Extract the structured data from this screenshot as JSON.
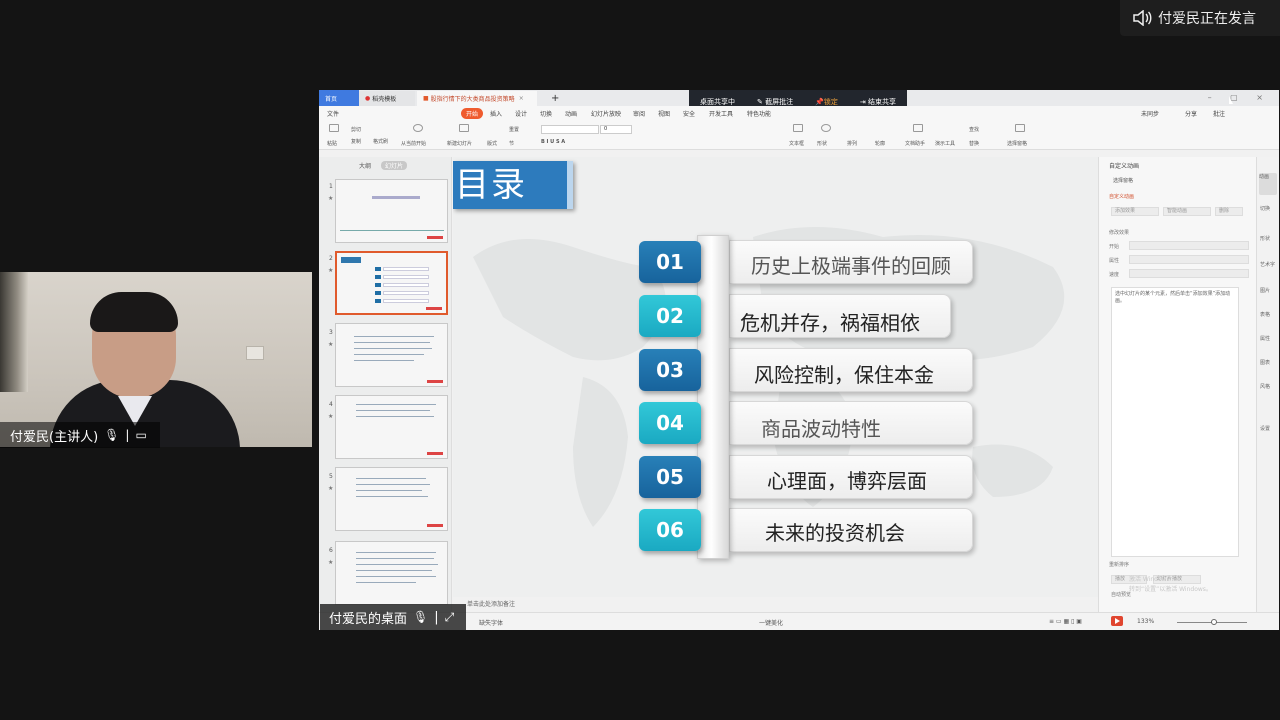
{
  "speaking_indicator": {
    "text": "付爱民正在发言",
    "icon": "speaker-icon"
  },
  "camera": {
    "name_label": "付爱民(主讲人)",
    "icons": [
      "mic-icon",
      "screen-icon"
    ]
  },
  "desktop_label": {
    "text": "付爱民的桌面",
    "icons": [
      "mic-icon",
      "expand-icon"
    ]
  },
  "wps": {
    "tabs": [
      {
        "label": "首页"
      },
      {
        "label": "稻壳模板"
      },
      {
        "label": "股指行情下的大类商品投资策略"
      }
    ],
    "share_bar": {
      "desktop_sharing": "桌面共享中",
      "annotate": "截屏批注",
      "pin": "锁定",
      "end_share": "结束共享"
    },
    "menu": [
      "文件",
      "开始",
      "插入",
      "设计",
      "切换",
      "动画",
      "幻灯片放映",
      "审阅",
      "视图",
      "安全",
      "开发工具",
      "特色功能"
    ],
    "menu_right": [
      "未同步",
      "分享",
      "批注"
    ],
    "ribbon_labels": [
      "粘贴",
      "剪切",
      "复制",
      "格式刷",
      "从当前开始",
      "新建幻灯片",
      "版式",
      "节",
      "重置",
      "文本框",
      "形状",
      "排列",
      "轮廓",
      "文档助手",
      "演示工具",
      "替换",
      "选择窗格",
      "查找"
    ],
    "font_size": "0",
    "thumb_tabs": {
      "outline": "大纲",
      "slides": "幻灯片"
    },
    "thumbnails": [
      {
        "num": "1",
        "kind": "title"
      },
      {
        "num": "2",
        "kind": "toc",
        "selected": true
      },
      {
        "num": "3",
        "kind": "text"
      },
      {
        "num": "4",
        "kind": "text"
      },
      {
        "num": "5",
        "kind": "text"
      },
      {
        "num": "6",
        "kind": "text"
      }
    ],
    "notes_placeholder": "单击此处添加备注",
    "status": {
      "font_missing": "缺失字体",
      "beautify": "一键美化",
      "zoom": "133%"
    }
  },
  "slide": {
    "title": "目录",
    "items": [
      {
        "num": "01",
        "text": "历史上极端事件的回顾",
        "style": "dark"
      },
      {
        "num": "02",
        "text": "危机并存，祸福相依",
        "style": "light"
      },
      {
        "num": "03",
        "text": "风险控制，保住本金",
        "style": "dark"
      },
      {
        "num": "04",
        "text": "商品波动特性",
        "style": "light"
      },
      {
        "num": "05",
        "text": "心理面，博弈层面",
        "style": "dark"
      },
      {
        "num": "06",
        "text": "未来的投资机会",
        "style": "light"
      }
    ]
  },
  "animation_panel": {
    "title": "自定义动画",
    "select_pane": "选择窗格",
    "section": "自定义动画",
    "add_effect": "添加效果",
    "smart_anim": "智能动画",
    "delete": "删除",
    "modify": "修改效果",
    "start_label": "开始",
    "property_label": "属性",
    "speed_label": "速度",
    "hint": "选中幻灯片的某个元素，然后单击“添加效果”添加动画。",
    "reorder": "重新排序",
    "play": "播放",
    "slideshow": "幻灯片播放",
    "autopreview": "自动预览",
    "watermark": "激活 Windows\n转到“设置”以激活 Windows。"
  },
  "side_tools": [
    "动画",
    "切换",
    "形状",
    "艺术字",
    "图片",
    "表格",
    "属性",
    "图表",
    "风格",
    "设置"
  ]
}
